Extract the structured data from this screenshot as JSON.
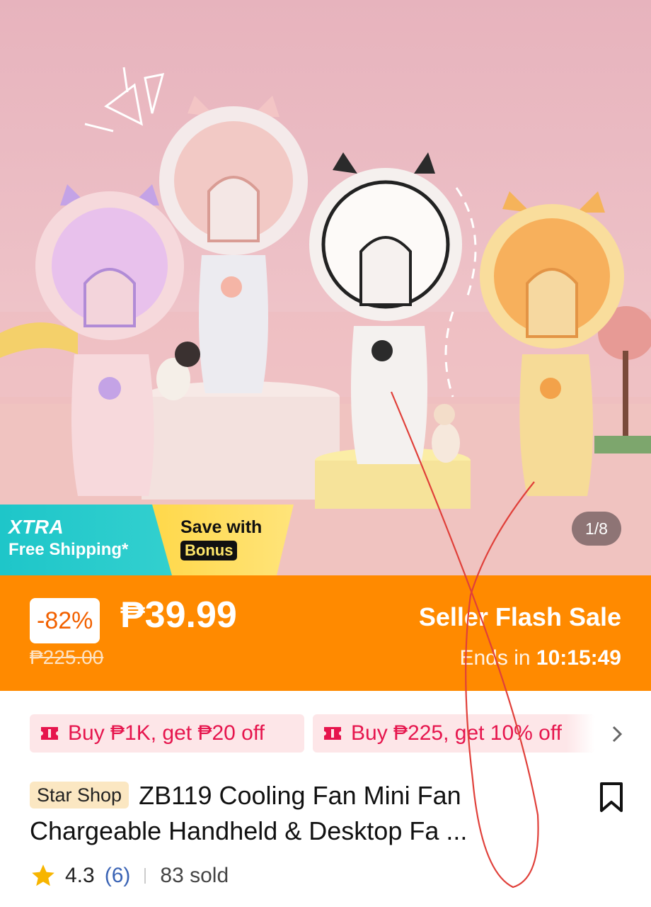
{
  "hero": {
    "image_counter": "1/8",
    "badge_xtra": {
      "line1": "XTRA",
      "line2": "Free Shipping*"
    },
    "badge_bonus": {
      "line1": "Save with",
      "line2": "Bonus"
    }
  },
  "flash_sale": {
    "discount": "-82%",
    "price": "₱39.99",
    "original_price": "₱225.00",
    "title": "Seller Flash Sale",
    "ends_label": "Ends in",
    "countdown": "10:15:49"
  },
  "vouchers": [
    {
      "label": "Buy ₱1K, get ₱20 off"
    },
    {
      "label": "Buy ₱225, get 10% off"
    }
  ],
  "product": {
    "shop_tag": "Star Shop",
    "title": "ZB119 Cooling Fan Mini Fan Chargeable Handheld & Desktop Fa ..."
  },
  "rating": {
    "score": "4.3",
    "reviews": "(6)",
    "sold": "83 sold"
  },
  "colors": {
    "flash_bg": "#ff8a00",
    "voucher_text": "#e6154d",
    "voucher_bg": "#fde6e8",
    "xtra_bg": "#1ec6c9",
    "bonus_bg": "#ffd84a",
    "star": "#f7b500",
    "review_link": "#3b64b5"
  },
  "icons": [
    "voucher-ticket-icon",
    "chevron-right-icon",
    "bookmark-icon",
    "star-icon"
  ]
}
